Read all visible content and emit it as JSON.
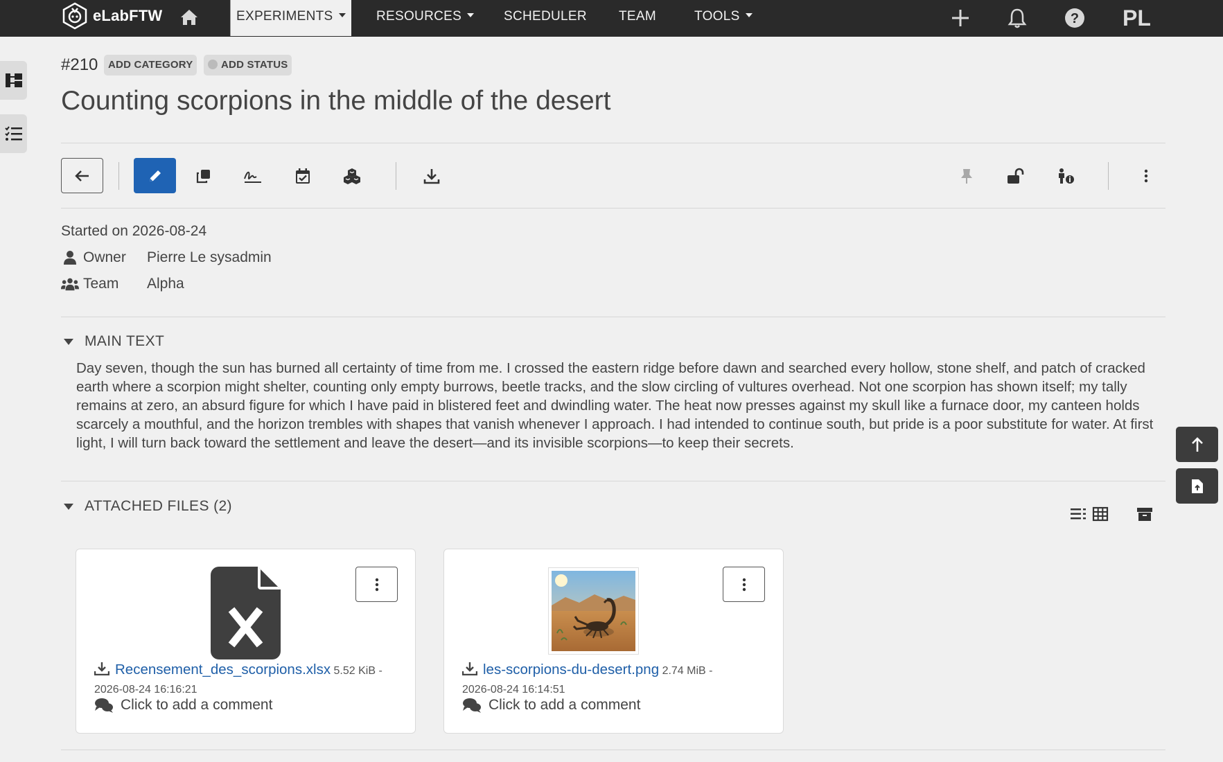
{
  "nav": {
    "brand": "eLabFTW",
    "items": [
      {
        "label": "EXPERIMENTS",
        "dropdown": true,
        "active": true
      },
      {
        "label": "RESOURCES",
        "dropdown": true
      },
      {
        "label": "SCHEDULER",
        "dropdown": false
      },
      {
        "label": "TEAM",
        "dropdown": false
      },
      {
        "label": "TOOLS",
        "dropdown": true
      }
    ],
    "avatar_initials": "PL",
    "icons": [
      "home-icon",
      "plus-icon",
      "bell-icon",
      "help-icon"
    ]
  },
  "entry": {
    "id": "#210",
    "add_category": "ADD CATEGORY",
    "add_status": "ADD STATUS",
    "title": "Counting scorpions in the middle of the desert",
    "started": "Started on 2026-08-24",
    "owner_label": "Owner",
    "owner_value": "Pierre Le sysadmin",
    "team_label": "Team",
    "team_value": "Alpha"
  },
  "main_text": {
    "heading": "MAIN TEXT",
    "body": "Day seven, though the sun has burned all certainty of time from me. I crossed the eastern ridge before dawn and searched every hollow, stone shelf, and patch of cracked earth where a scorpion might shelter, counting only empty burrows, beetle tracks, and the slow circling of vultures overhead. Not one scorpion has shown itself; my tally remains at zero, an absurd figure for which I have paid in blistered feet and dwindling water. The heat now presses against my skull like a furnace door, my canteen holds scarcely a mouthful, and the horizon trembles with shapes that vanish whenever I approach. I had intended to continue south, but pride is a poor substitute for water. At first light, I will turn back toward the settlement and leave the desert—and its invisible scorpions—to keep their secrets."
  },
  "attachments": {
    "heading": "ATTACHED FILES (2)",
    "files": [
      {
        "name": "Recensement_des_scorpions.xlsx",
        "size": "5.52 KiB -",
        "date": "2026-08-24 16:16:21",
        "comment": "Click to add a comment",
        "kind": "xlsx"
      },
      {
        "name": "les-scorpions-du-desert.png",
        "size": "2.74 MiB -",
        "date": "2026-08-24 16:14:51",
        "comment": "Click to add a comment",
        "kind": "image"
      }
    ]
  },
  "colors": {
    "nav_bg": "#2a2a2a",
    "accent": "#1f63b4",
    "link": "#1f5fa8"
  }
}
